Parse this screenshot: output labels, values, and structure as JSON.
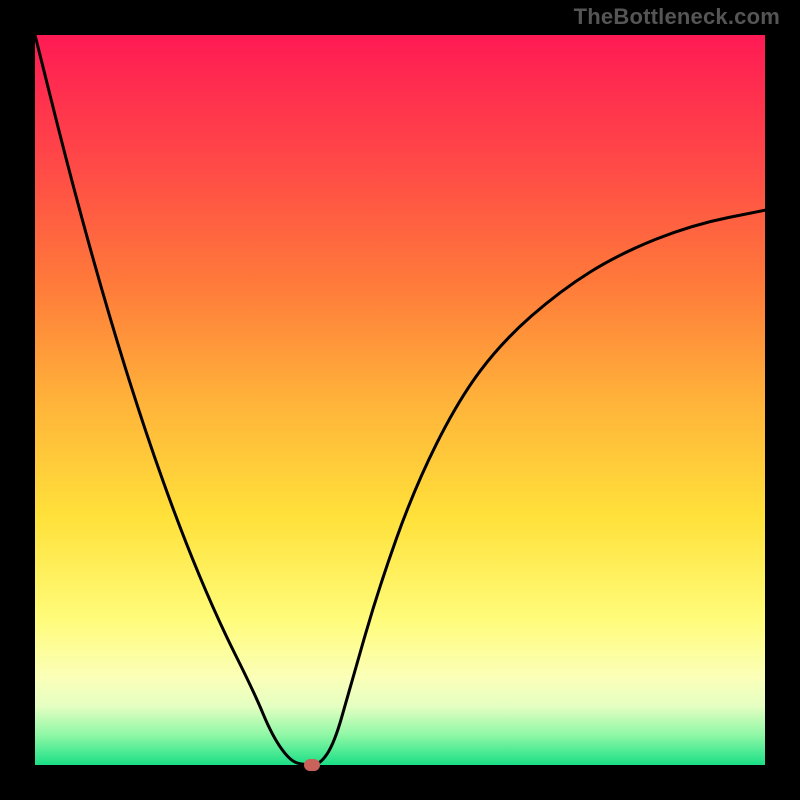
{
  "watermark": "TheBottleneck.com",
  "chart_data": {
    "type": "line",
    "title": "",
    "xlabel": "",
    "ylabel": "",
    "xlim": [
      0,
      1
    ],
    "ylim": [
      0,
      1
    ],
    "series": [
      {
        "name": "curve",
        "x": [
          0.0,
          0.05,
          0.1,
          0.15,
          0.2,
          0.25,
          0.3,
          0.325,
          0.35,
          0.37,
          0.39,
          0.41,
          0.43,
          0.47,
          0.52,
          0.58,
          0.64,
          0.72,
          0.8,
          0.9,
          1.0
        ],
        "y": [
          1.0,
          0.8,
          0.62,
          0.46,
          0.32,
          0.2,
          0.1,
          0.04,
          0.005,
          0.0,
          0.0,
          0.03,
          0.1,
          0.24,
          0.38,
          0.5,
          0.58,
          0.65,
          0.7,
          0.74,
          0.76
        ]
      }
    ],
    "markers": [
      {
        "x": 0.38,
        "y": 0.0,
        "shape": "pill",
        "color": "#c8625a"
      }
    ],
    "background_gradient": {
      "direction": "vertical",
      "stops": [
        {
          "pos": 0.0,
          "color": "#ff1a54"
        },
        {
          "pos": 0.5,
          "color": "#ffb23a"
        },
        {
          "pos": 0.8,
          "color": "#fffc7a"
        },
        {
          "pos": 1.0,
          "color": "#1adf86"
        }
      ]
    }
  },
  "frame": {
    "border_px": 35,
    "border_color": "#000000"
  }
}
